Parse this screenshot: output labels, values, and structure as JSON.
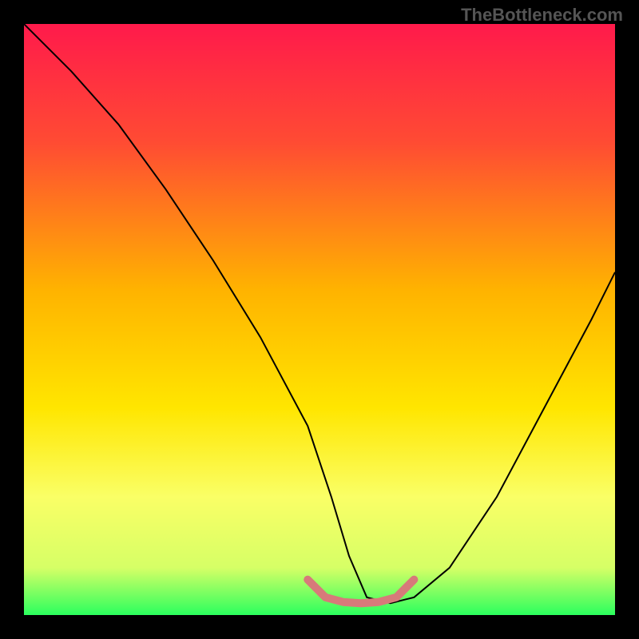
{
  "watermark": "TheBottleneck.com",
  "chart_data": {
    "type": "line",
    "title": "",
    "xlabel": "",
    "ylabel": "",
    "xlim": [
      0,
      100
    ],
    "ylim": [
      0,
      100
    ],
    "gradient_stops": [
      {
        "offset": 0,
        "color": "#ff1a4b"
      },
      {
        "offset": 20,
        "color": "#ff4b33"
      },
      {
        "offset": 45,
        "color": "#ffb300"
      },
      {
        "offset": 65,
        "color": "#ffe600"
      },
      {
        "offset": 80,
        "color": "#faff66"
      },
      {
        "offset": 92,
        "color": "#d6ff66"
      },
      {
        "offset": 100,
        "color": "#2bff5e"
      }
    ],
    "series": [
      {
        "name": "bottleneck-curve",
        "stroke": "#000000",
        "x": [
          0,
          8,
          16,
          24,
          32,
          40,
          48,
          52,
          55,
          58,
          62,
          66,
          72,
          80,
          88,
          96,
          100
        ],
        "values": [
          100,
          92,
          83,
          72,
          60,
          47,
          32,
          20,
          10,
          3,
          2,
          3,
          8,
          20,
          35,
          50,
          58
        ]
      }
    ],
    "trough_marker": {
      "color": "#d77a7a",
      "x": [
        48,
        51,
        54,
        57,
        60,
        63,
        66
      ],
      "values": [
        6,
        3,
        2.2,
        2,
        2.2,
        3,
        6
      ]
    }
  }
}
